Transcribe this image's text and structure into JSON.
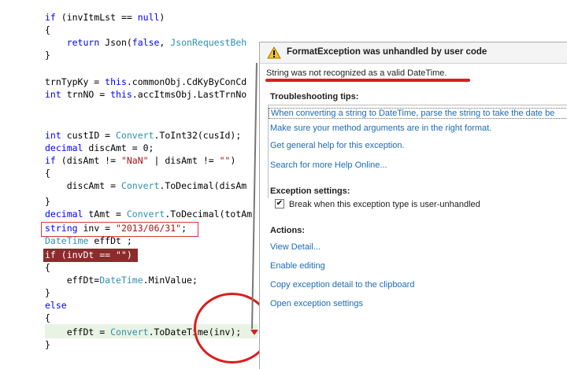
{
  "code": {
    "lines": [
      {
        "html": "<span class=\"kw\">if</span> (invItmLst == <span class=\"kw\">null</span>)"
      },
      {
        "html": "{"
      },
      {
        "html": "    <span class=\"kw\">return</span> Json(<span class=\"kw\">false</span>, <span class=\"ty\">JsonRequestBeh</span>"
      },
      {
        "html": "}"
      },
      {
        "html": ""
      },
      {
        "html": "trnTypKy = <span class=\"kw\">this</span>.commonObj.CdKyByConCd"
      },
      {
        "html": "<span class=\"kw\">int</span> trnNO = <span class=\"kw\">this</span>.accItmsObj.LastTrnNo"
      },
      {
        "html": ""
      },
      {
        "html": ""
      },
      {
        "html": "<span class=\"kw\">int</span> custID = <span class=\"ty\">Convert</span>.ToInt32(cusId);"
      },
      {
        "html": "<span class=\"kw\">decimal</span> discAmt = 0;"
      },
      {
        "html": "<span class=\"kw\">if</span> (disAmt != <span class=\"str\">\"NaN\"</span> | disAmt != <span class=\"str\">\"\"</span>)"
      },
      {
        "html": "{"
      },
      {
        "html": "    discAmt = <span class=\"ty\">Convert</span>.ToDecimal(disAm"
      },
      {
        "html": "}"
      },
      {
        "html": "<span class=\"kw\">decimal</span> tAmt = <span class=\"ty\">Convert</span>.ToDecimal(totAm"
      },
      {
        "html": "<span class=\"kw\">string</span> inv = <span class=\"str\">\"2013/06/31\"</span>;"
      },
      {
        "html": "<span class=\"ty\">DateTime</span> effDt ;"
      },
      {
        "html": "if (invDt == \"\")"
      },
      {
        "html": "{"
      },
      {
        "html": "    effDt=<span class=\"ty\">DateTime</span>.MinValue;"
      },
      {
        "html": "}"
      },
      {
        "html": "<span class=\"kw\">else</span>"
      },
      {
        "html": "{"
      },
      {
        "html": "    effDt = <span class=\"ty\">Convert</span>.ToDateTime(inv);"
      },
      {
        "html": "}"
      }
    ]
  },
  "popup": {
    "title": "FormatException was unhandled by user code",
    "message": "String was not recognized as a valid DateTime.",
    "tips_heading": "Troubleshooting tips:",
    "tips": [
      "When converting a string to DateTime, parse the string to take the date be",
      "Make sure your method arguments are in the right format.",
      "Get general help for this exception."
    ],
    "search_online": "Search for more Help Online...",
    "settings_heading": "Exception settings:",
    "break_checkbox_label": "Break when this exception type is user-unhandled",
    "break_checked": true,
    "actions_heading": "Actions:",
    "actions": [
      "View Detail...",
      "Enable editing",
      "Copy exception detail to the clipboard",
      "Open exception settings"
    ]
  },
  "colors": {
    "keyword": "#0000ff",
    "type": "#2b91af",
    "string": "#a31515",
    "link": "#1c6bb5",
    "annotation_red": "#d81e1e"
  },
  "icons": {
    "warning": "warning-triangle-icon"
  }
}
